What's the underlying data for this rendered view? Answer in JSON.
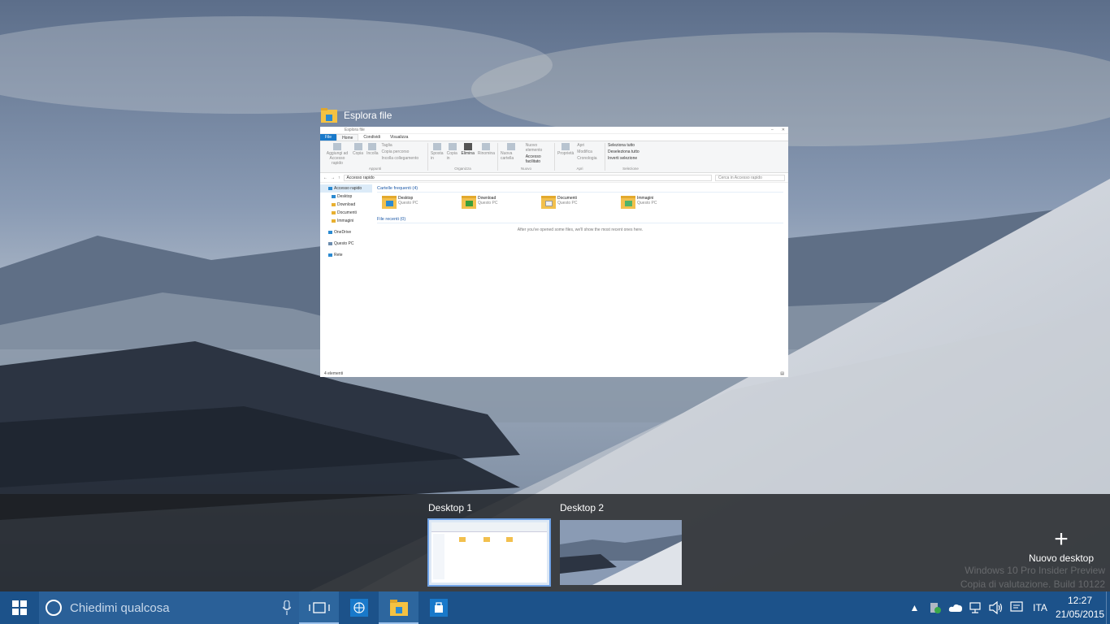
{
  "window": {
    "title": "Esplora file",
    "inner_title": "Esplora file",
    "tabs": [
      "File",
      "Home",
      "Condividi",
      "Visualizza"
    ],
    "ribbon": {
      "appunti": {
        "label": "Appunti",
        "pin": "Aggiungi ad Accesso rapido",
        "copy": "Copia",
        "paste": "Incolla",
        "cut": "Taglia",
        "copy_path": "Copia percorso",
        "paste_link": "Incolla collegamento"
      },
      "organizza": {
        "label": "Organizza",
        "move": "Sposta in",
        "copy_to": "Copia in",
        "delete": "Elimina",
        "rename": "Rinomina"
      },
      "nuovo": {
        "label": "Nuovo",
        "new_folder": "Nuova cartella",
        "new_item": "Nuovo elemento",
        "easy_access": "Accesso facilitato"
      },
      "apri": {
        "label": "Apri",
        "properties": "Proprietà",
        "open": "Apri",
        "edit": "Modifica",
        "history": "Cronologia"
      },
      "selezione": {
        "label": "Selezione",
        "select_all": "Seleziona tutto",
        "select_none": "Deseleziona tutto",
        "invert": "Inverti selezione"
      }
    },
    "address": "Accesso rapido",
    "search_placeholder": "Cerca in Accesso rapido",
    "nav": {
      "quick": "Accesso rapido",
      "desktop": "Desktop",
      "download": "Download",
      "documents": "Documenti",
      "images": "Immagini",
      "onedrive": "OneDrive",
      "thispc": "Questo PC",
      "network": "Rete"
    },
    "frequent_header": "Cartelle frequenti (4)",
    "folders": [
      {
        "name": "Desktop",
        "loc": "Questo PC"
      },
      {
        "name": "Download",
        "loc": "Questo PC"
      },
      {
        "name": "Documenti",
        "loc": "Questo PC"
      },
      {
        "name": "Immagini",
        "loc": "Questo PC"
      }
    ],
    "recent_header": "File recenti (0)",
    "recent_empty": "After you've opened some files, we'll show the most recent ones here.",
    "status": "4 elementi"
  },
  "desktops": {
    "d1": "Desktop 1",
    "d2": "Desktop 2",
    "new": "Nuovo desktop"
  },
  "watermark": {
    "line1": "Windows 10 Pro Insider Preview",
    "line2": "Copia di valutazione. Build 10122"
  },
  "taskbar": {
    "search_placeholder": "Chiedimi qualcosa",
    "lang": "ITA",
    "time": "12:27",
    "date": "21/05/2015"
  },
  "colors": {
    "taskbar": "#1c528a",
    "accent": "#1979ca",
    "selection_border": "#6fa2e6"
  }
}
